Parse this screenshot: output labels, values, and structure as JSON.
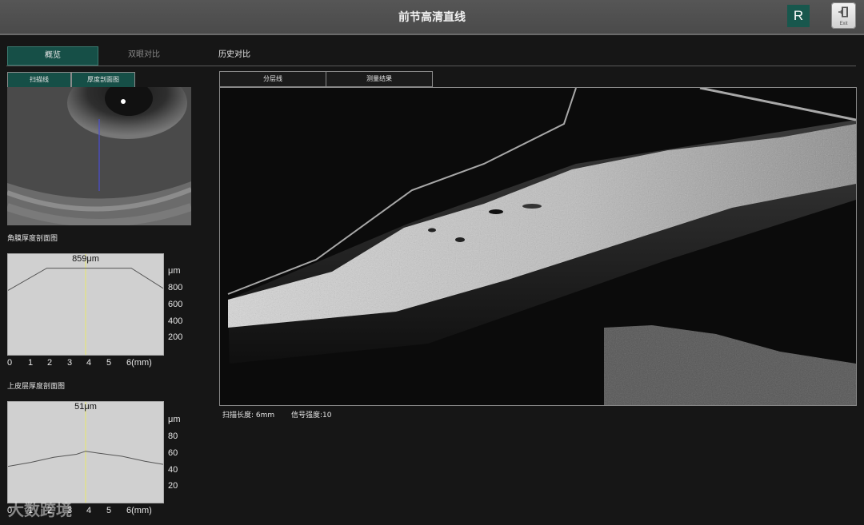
{
  "header": {
    "title": "前节高清直线",
    "eye_badge": "R",
    "exit_label": "Exit"
  },
  "main_tabs": [
    {
      "label": "概览",
      "active": true
    },
    {
      "label": "双眼对比",
      "active": false
    },
    {
      "label": "历史对比",
      "active": false
    }
  ],
  "left_tabs": [
    {
      "label": "扫描线",
      "active": true
    },
    {
      "label": "厚度剖面图",
      "active": false
    }
  ],
  "right_tabs": [
    {
      "label": "分层线"
    },
    {
      "label": "测量结果"
    }
  ],
  "cornea_chart": {
    "title": "角膜厚度剖面图",
    "readout": "859μm",
    "unit": "μm",
    "y_ticks": [
      "800",
      "600",
      "400",
      "200"
    ],
    "x_ticks": [
      "0",
      "1",
      "2",
      "3",
      "4",
      "5",
      "6(mm)"
    ]
  },
  "epi_chart": {
    "title": "上皮层厚度剖面图",
    "readout": "51μm",
    "unit": "μm",
    "y_ticks": [
      "80",
      "60",
      "40",
      "20"
    ],
    "x_ticks": [
      "0",
      "1",
      "2",
      "3",
      "4",
      "5",
      "6(mm)"
    ]
  },
  "status": {
    "scan_length": "扫描长度:  6mm",
    "signal": "信号强度:10"
  },
  "watermark": "大数跨境",
  "colors": {
    "accent_green": "#164f47",
    "badge_green": "#18574d",
    "background": "#161616"
  },
  "chart_data": [
    {
      "type": "line",
      "title": "角膜厚度剖面图",
      "xlabel": "mm",
      "ylabel": "μm",
      "xlim": [
        0,
        6.8
      ],
      "ylim": [
        0,
        1000
      ],
      "series": [
        {
          "x": [
            0,
            1.7,
            5.4,
            6.8
          ],
          "values": [
            640,
            860,
            860,
            660
          ]
        }
      ],
      "cursor_x": 3.4,
      "cursor_value": 859
    },
    {
      "type": "line",
      "title": "上皮层厚度剖面图",
      "xlabel": "mm",
      "ylabel": "μm",
      "xlim": [
        0,
        6.8
      ],
      "ylim": [
        0,
        100
      ],
      "series": [
        {
          "x": [
            0,
            1,
            2,
            3,
            3.4,
            4,
            5,
            6,
            6.8
          ],
          "values": [
            36,
            40,
            45,
            48,
            51,
            49,
            46,
            41,
            38
          ]
        }
      ],
      "cursor_x": 3.4,
      "cursor_value": 51
    }
  ]
}
